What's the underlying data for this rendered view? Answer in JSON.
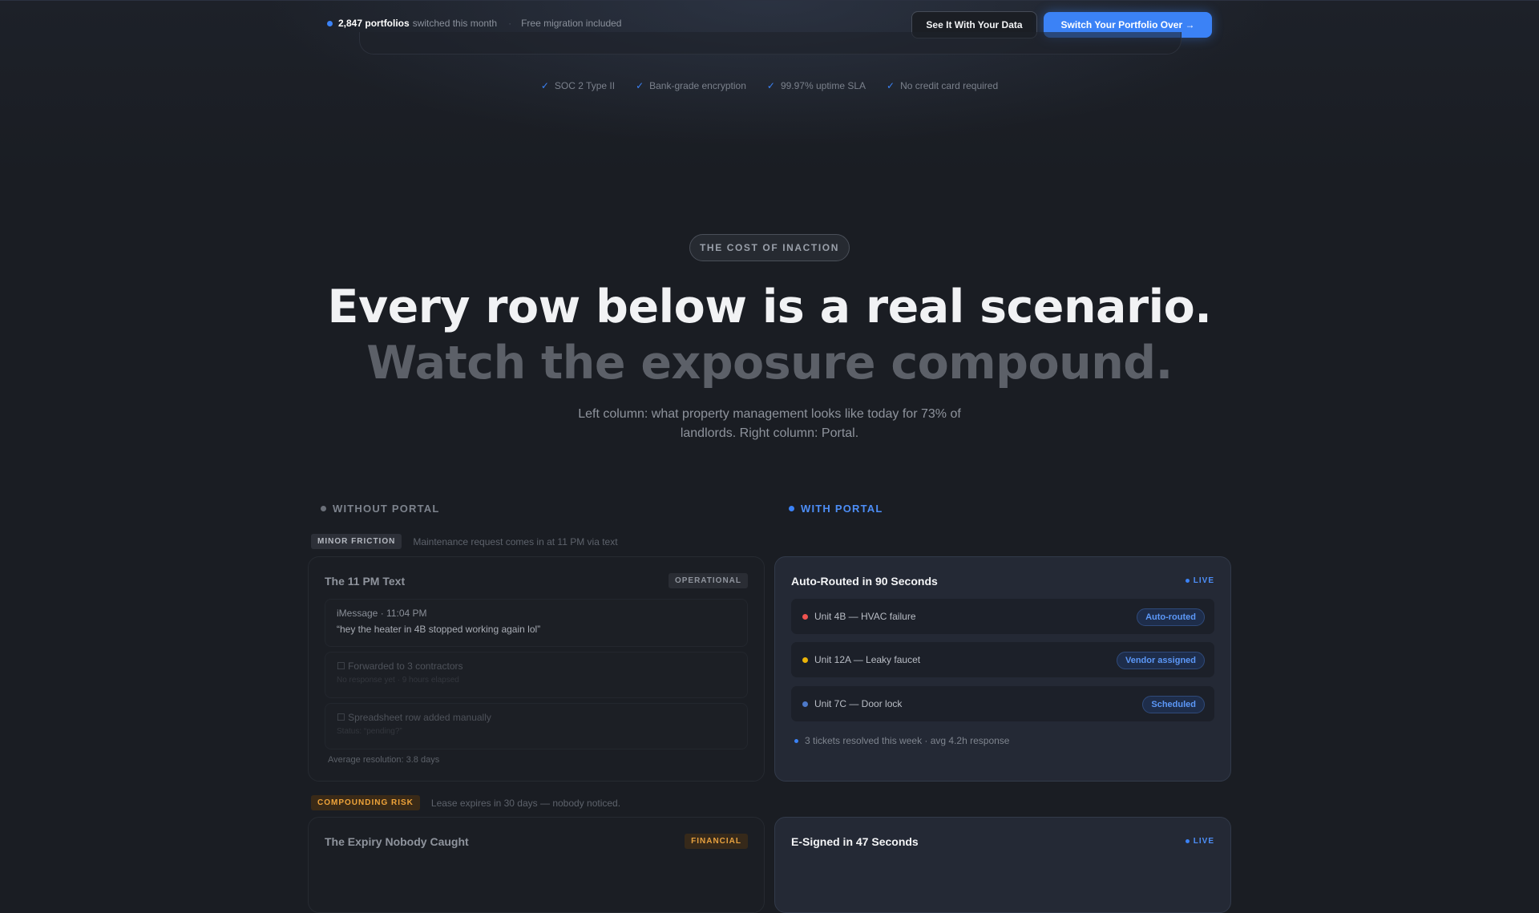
{
  "topbar": {
    "stat_number": "2,847 portfolios",
    "stat_suffix": "switched this month",
    "separator": "·",
    "migration": "Free migration included",
    "secondary_button": "See It With Your Data",
    "primary_button": "Switch Your Portfolio Over →"
  },
  "trust": [
    {
      "icon": "check-icon",
      "label": "SOC 2 Type II"
    },
    {
      "icon": "check-icon",
      "label": "Bank-grade encryption"
    },
    {
      "icon": "check-icon",
      "label": "99.97% uptime SLA"
    },
    {
      "icon": "check-icon",
      "label": "No credit card required"
    }
  ],
  "section": {
    "eyebrow": "THE COST OF INACTION",
    "headline_1": "Every row below is a real scenario.",
    "headline_2": "Watch the exposure compound.",
    "lede": "Left column: what property management looks like today for 73% of landlords. Right column: Portal."
  },
  "columns": {
    "left_label": "WITHOUT PORTAL",
    "right_label": "WITH PORTAL"
  },
  "rows": [
    {
      "tag": "MINOR FRICTION",
      "scenario": "Maintenance request comes in at 11 PM via text",
      "old": {
        "title": "The 11 PM Text",
        "badge": "OPERATIONAL",
        "message_meta": "iMessage · 11:04 PM",
        "message_text": "“hey the heater in 4B stopped working again lol”",
        "step1": "☐ Forwarded to 3 contractors",
        "step1_sub": "No response yet · 9 hours elapsed",
        "step2": "☐ Spreadsheet row added manually",
        "step2_sub": "Status: “pending?”",
        "footnote": "Average resolution: 3.8 days"
      },
      "new": {
        "title": "Auto-Routed in 90 Seconds",
        "live": "LIVE",
        "tickets": [
          {
            "label": "Unit 4B — HVAC failure",
            "status": "Auto-routed",
            "color": "#ef5350"
          },
          {
            "label": "Unit 12A — Leaky faucet",
            "status": "Vendor assigned",
            "color": "#eab308"
          },
          {
            "label": "Unit 7C — Door lock",
            "status": "Scheduled",
            "color": "#4d79c9"
          }
        ],
        "footnote": "3 tickets resolved this week · avg 4.2h response"
      }
    },
    {
      "tag": "COMPOUNDING RISK",
      "scenario": "Lease expires in 30 days — nobody noticed.",
      "old": {
        "title": "The Expiry Nobody Caught",
        "badge": "FINANCIAL"
      },
      "new": {
        "title": "E-Signed in 47 Seconds",
        "live": "LIVE"
      }
    }
  ],
  "colors": {
    "accent": "#3b82f6",
    "background": "#1a1d23",
    "risk": "#f0a43a"
  }
}
